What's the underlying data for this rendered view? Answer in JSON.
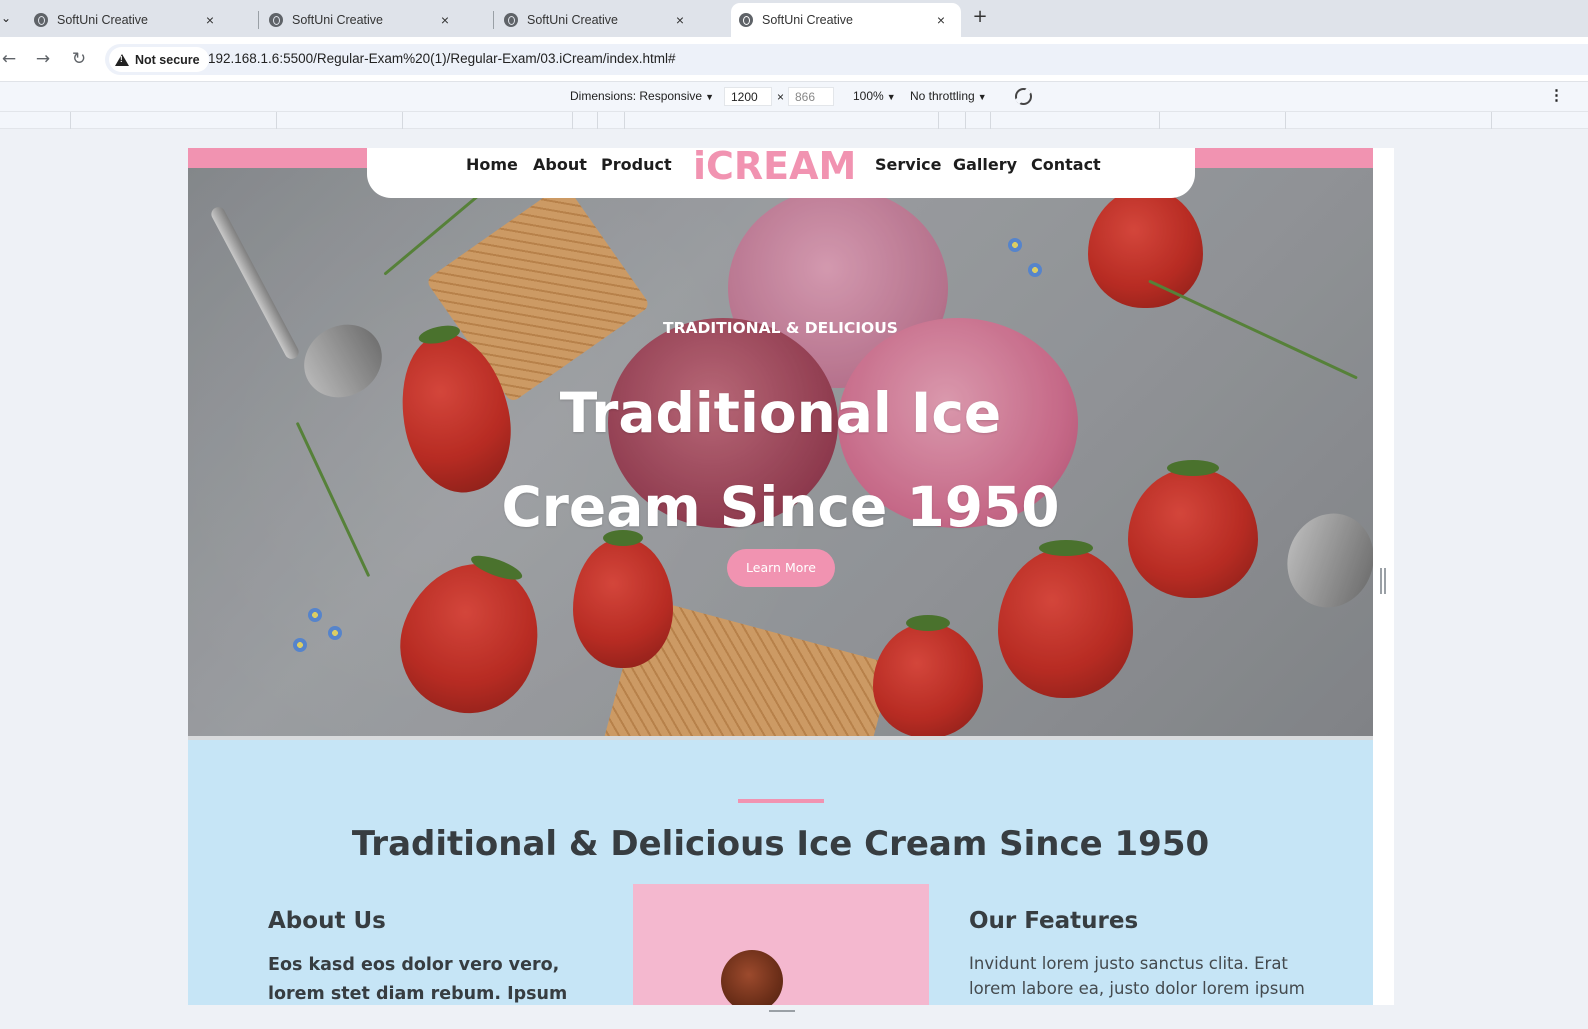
{
  "browser": {
    "tabs": [
      {
        "title": "SoftUni Creative",
        "active": false
      },
      {
        "title": "SoftUni Creative",
        "active": false
      },
      {
        "title": "SoftUni Creative",
        "active": false
      },
      {
        "title": "SoftUni Creative",
        "active": true
      }
    ],
    "new_tab_label": "+",
    "close_label": "×",
    "security_label": "Not secure",
    "url": "192.168.1.6:5500/Regular-Exam%20(1)/Regular-Exam/03.iCream/index.html#"
  },
  "devtools": {
    "dimensions_label": "Dimensions: Responsive",
    "width": "1200",
    "times": "×",
    "height": "866",
    "zoom": "100%",
    "throttling": "No throttling"
  },
  "site": {
    "brand_color": "#f193b1",
    "nav_left": [
      "Home",
      "About",
      "Product"
    ],
    "logo": "iCREAM",
    "nav_right": [
      "Service",
      "Gallery",
      "Contact"
    ],
    "hero": {
      "subtitle": "TRADITIONAL & DELICIOUS",
      "title_line1": "Traditional Ice",
      "title_line2": "Cream Since 1950",
      "button": "Learn More"
    },
    "about": {
      "heading": "Traditional & Delicious Ice Cream Since 1950",
      "about_title": "About Us",
      "about_text": "Eos kasd eos dolor vero vero, lorem stet diam rebum. Ipsum",
      "features_title": "Our Features",
      "features_text": "Invidunt lorem justo sanctus clita. Erat lorem labore ea, justo dolor lorem ipsum"
    }
  }
}
